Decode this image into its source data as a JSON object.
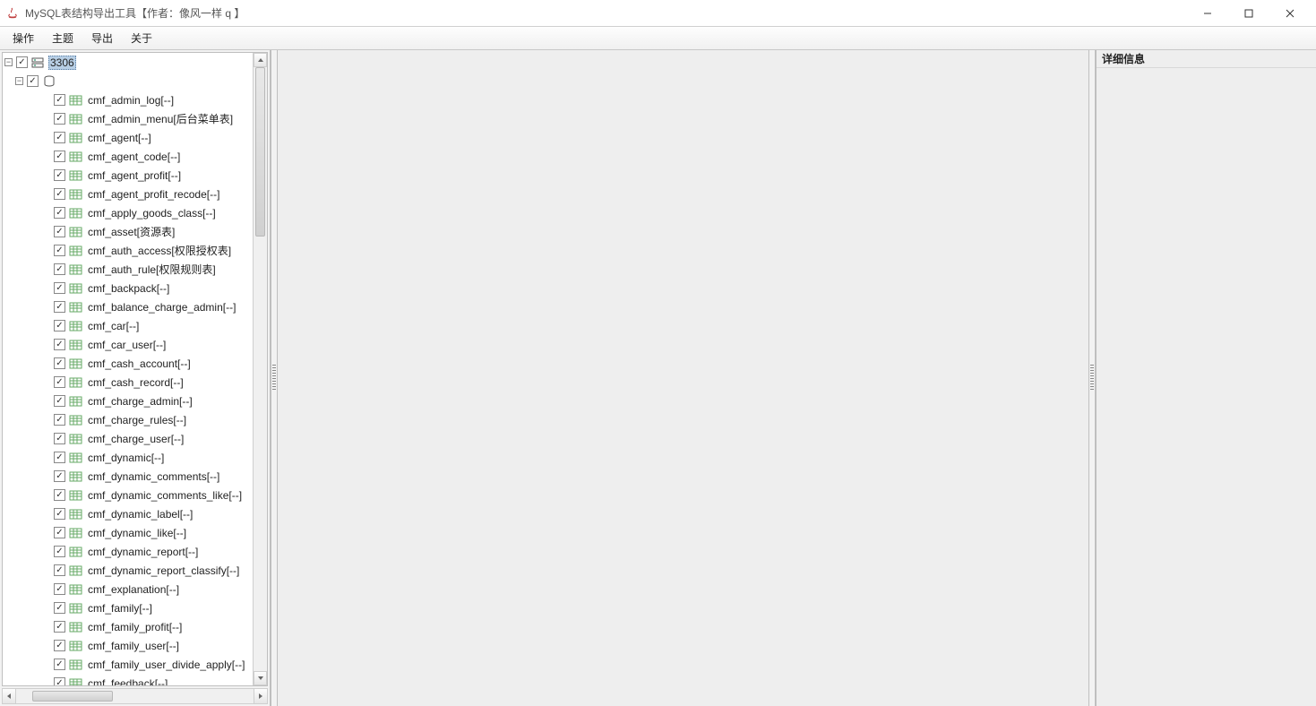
{
  "window": {
    "title": "MySQL表结构导出工具【作者：像风一样 q               】"
  },
  "menu": {
    "items": [
      "操作",
      "主题",
      "导出",
      "关于"
    ]
  },
  "tree": {
    "root_label": "            3306",
    "db_label": " ",
    "tables": [
      "cmf_admin_log[--]",
      "cmf_admin_menu[后台菜单表]",
      "cmf_agent[--]",
      "cmf_agent_code[--]",
      "cmf_agent_profit[--]",
      "cmf_agent_profit_recode[--]",
      "cmf_apply_goods_class[--]",
      "cmf_asset[资源表]",
      "cmf_auth_access[权限授权表]",
      "cmf_auth_rule[权限规则表]",
      "cmf_backpack[--]",
      "cmf_balance_charge_admin[--]",
      "cmf_car[--]",
      "cmf_car_user[--]",
      "cmf_cash_account[--]",
      "cmf_cash_record[--]",
      "cmf_charge_admin[--]",
      "cmf_charge_rules[--]",
      "cmf_charge_user[--]",
      "cmf_dynamic[--]",
      "cmf_dynamic_comments[--]",
      "cmf_dynamic_comments_like[--]",
      "cmf_dynamic_label[--]",
      "cmf_dynamic_like[--]",
      "cmf_dynamic_report[--]",
      "cmf_dynamic_report_classify[--]",
      "cmf_explanation[--]",
      "cmf_family[--]",
      "cmf_family_profit[--]",
      "cmf_family_user[--]",
      "cmf_family_user_divide_apply[--]",
      "cmf_feedback[--]"
    ]
  },
  "detail_panel": {
    "title": "详细信息"
  }
}
